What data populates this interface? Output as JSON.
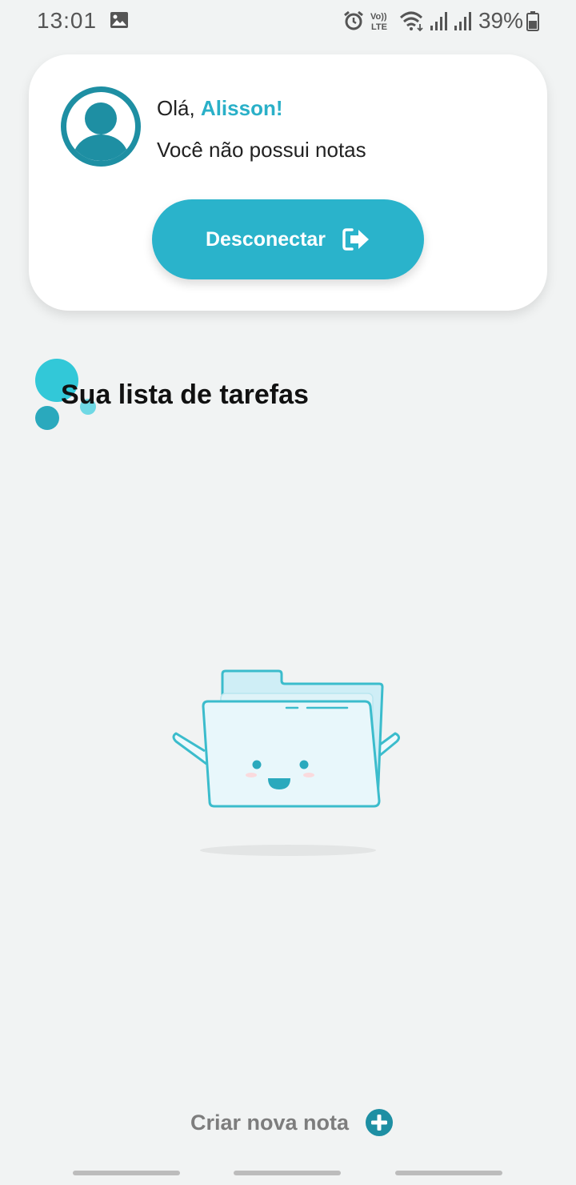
{
  "status_bar": {
    "time": "13:01",
    "battery_percent": "39%",
    "volte_top": "Vo))",
    "volte_bottom": "LTE",
    "icons": [
      "gallery-icon",
      "alarm-icon",
      "volte-icon",
      "wifi-icon",
      "signal-icon",
      "signal-icon",
      "battery-icon"
    ]
  },
  "profile": {
    "greeting_prefix": "Olá, ",
    "user_name": "Alisson!",
    "notes_status": "Você não possui notas",
    "logout_label": "Desconectar",
    "logout_icon": "logout-icon"
  },
  "tasks": {
    "section_title": "Sua lista de tarefas",
    "empty_illustration": "folder-illustration"
  },
  "actions": {
    "create_note_label": "Criar nova nota",
    "create_note_icon": "plus-circle-icon"
  },
  "colors": {
    "accent": "#2ab3cb",
    "accent_dark": "#1e8fa3",
    "background": "#f1f3f3",
    "card": "#ffffff",
    "muted_text": "#7d7d7d"
  }
}
